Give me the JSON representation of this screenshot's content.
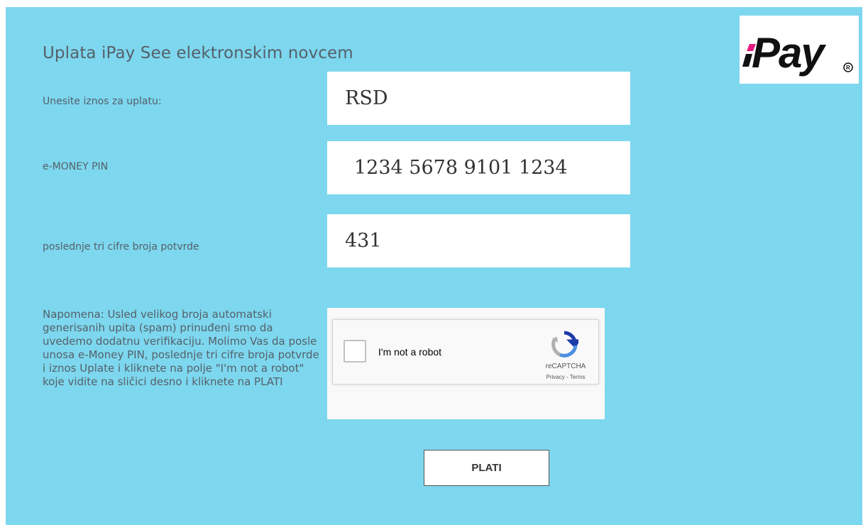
{
  "form": {
    "title": "Uplata iPay See elektronskim novcem",
    "amount_label": "Unesite iznos za uplatu:",
    "amount_value": "RSD",
    "pin_label": "e-MONEY PIN",
    "pin_value": "1234 5678 9101 1234",
    "confirm_label": "poslednje tri cifre broja potvrde",
    "confirm_value": "431",
    "note": "Napomena: Usled velikog broja automatski generisanih upita (spam) prinuđeni smo da uvedemo dodatnu verifikaciju. Molimo Vas da posle unosa e-Money PIN, poslednje tri cifre broja potvrde i iznos Uplate i kliknete na polje \"I'm not a robot\" koje vidite na sličici desno i kliknete na PLATI",
    "submit_label": "PLATI"
  },
  "captcha": {
    "label": "I'm not a robot",
    "brand": "reCAPTCHA",
    "links": "Privacy - Terms",
    "icon": "recaptcha-logo-icon"
  },
  "logo": {
    "text": "iPay",
    "registered": "®",
    "accent_color": "#e6197e"
  },
  "colors": {
    "panel_background": "#7dd7ee",
    "text": "#55606a"
  }
}
